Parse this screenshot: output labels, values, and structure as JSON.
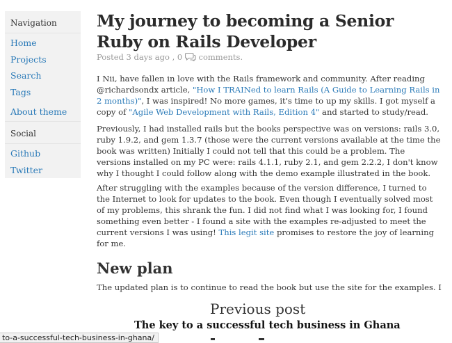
{
  "sidebar": {
    "navigation_heading": "Navigation",
    "nav_items": [
      "Home",
      "Projects",
      "Search",
      "Tags",
      "About theme"
    ],
    "social_heading": "Social",
    "social_items": [
      "Github",
      "Twitter"
    ]
  },
  "post": {
    "title": "My journey to becoming a Senior Ruby on Rails Developer",
    "meta_posted": "Posted 3 days ago , 0",
    "meta_comments": "comments.",
    "p1_a": "I Nii, have fallen in love with the Rails framework and community. After reading @richardsondx article, ",
    "p1_link1": "\"How I TRAINed to learn Rails (A Guide to Learning Rails in 2 months)\"",
    "p1_b": ", I was inspired! No more games, it's time to up my skills. I got myself a copy of ",
    "p1_link2": "\"Agile Web Development with Rails, Edition 4\"",
    "p1_c": " and started to study/read.",
    "p2": "Previously, I had installed rails but the books perspective was on versions: rails 3.0, ruby 1.9.2, and gem 1.3.7 (those were the current versions available at the time the book was written) Initially I could not tell that this could be a problem. The versions installed on my PC were: rails 4.1.1, ruby 2.1, and gem 2.2.2, I don't know why I thought I could follow along with the demo example illustrated in the book.",
    "p3_a": "After struggling with the examples because of the version difference, I turned to the Internet to look for updates to the book. Even though I eventually solved most of my problems, this shrank the fun. I did not find what I was looking for, I found something even better - I found a site with the examples re-adjusted to meet the current versions I was using! ",
    "p3_link": "This legit site",
    "p3_b": " promises to restore the joy of learning for me.",
    "h2": "New plan",
    "p4": "The updated plan is to continue to read the book but use the site for the examples. I"
  },
  "footer": {
    "previous_heading": "Previous post",
    "previous_link": "The key to a successful tech business in Ghana",
    "status_url": "to-a-successful-tech-business-in-ghana/"
  },
  "colors": {
    "link": "#2a7ab8",
    "sidebar_bg": "#f2f2f2",
    "meta": "#999999"
  },
  "icons": {
    "comment": "comment-bubble-icon"
  }
}
